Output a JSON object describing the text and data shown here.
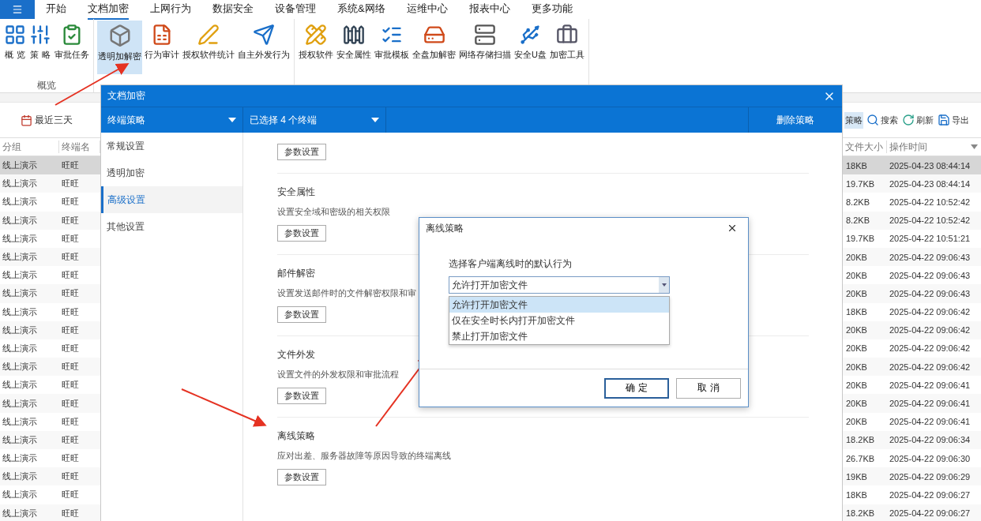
{
  "ribbon": {
    "tabs": [
      {
        "label": "开始",
        "selected": false
      },
      {
        "label": "文档加密",
        "selected": true
      },
      {
        "label": "上网行为",
        "selected": false
      },
      {
        "label": "数据安全",
        "selected": false
      },
      {
        "label": "设备管理",
        "selected": false
      },
      {
        "label": "系统&网络",
        "selected": false
      },
      {
        "label": "运维中心",
        "selected": false
      },
      {
        "label": "报表中心",
        "selected": false
      },
      {
        "label": "更多功能",
        "selected": false
      }
    ],
    "groups": [
      {
        "label": "概览",
        "buttons": [
          {
            "label": "概 览",
            "selected": false
          },
          {
            "label": "策 略",
            "selected": false
          },
          {
            "label": "审批任务",
            "selected": false
          }
        ]
      },
      {
        "buttons": [
          {
            "label": "透明加解密",
            "selected": true
          },
          {
            "label": "行为审计",
            "selected": false
          },
          {
            "label": "授权软件统计",
            "selected": false
          },
          {
            "label": "自主外发行为",
            "selected": false
          }
        ]
      },
      {
        "buttons": [
          {
            "label": "授权软件",
            "selected": false
          },
          {
            "label": "安全属性",
            "selected": false
          },
          {
            "label": "审批模板",
            "selected": false
          },
          {
            "label": "全盘加解密",
            "selected": false
          },
          {
            "label": "网络存储扫描",
            "selected": false
          },
          {
            "label": "安全U盘",
            "selected": false
          },
          {
            "label": "加密工具",
            "selected": false
          }
        ]
      }
    ]
  },
  "toolbar_left": {
    "date_range": "最近三天"
  },
  "toolbar_right": [
    {
      "label": "策略",
      "selected": true
    },
    {
      "label": "搜索",
      "selected": false
    },
    {
      "label": "刷新",
      "selected": false
    },
    {
      "label": "导出",
      "selected": false
    }
  ],
  "table": {
    "columns": [
      "分组",
      "终端名",
      "文件大小",
      "操作时间"
    ],
    "rows": [
      {
        "group": "线上演示",
        "terminal": "旺旺",
        "size": "18KB",
        "time": "2025-04-23 08:44:14",
        "selected": true
      },
      {
        "group": "线上演示",
        "terminal": "旺旺",
        "size": "19.7KB",
        "time": "2025-04-23 08:44:14",
        "selected": false
      },
      {
        "group": "线上演示",
        "terminal": "旺旺",
        "size": "8.2KB",
        "time": "2025-04-22 10:52:42",
        "selected": false
      },
      {
        "group": "线上演示",
        "terminal": "旺旺",
        "size": "8.2KB",
        "time": "2025-04-22 10:52:42",
        "selected": false
      },
      {
        "group": "线上演示",
        "terminal": "旺旺",
        "size": "19.7KB",
        "time": "2025-04-22 10:51:21",
        "selected": false
      },
      {
        "group": "线上演示",
        "terminal": "旺旺",
        "size": "20KB",
        "time": "2025-04-22 09:06:43",
        "selected": false
      },
      {
        "group": "线上演示",
        "terminal": "旺旺",
        "size": "20KB",
        "time": "2025-04-22 09:06:43",
        "selected": false
      },
      {
        "group": "线上演示",
        "terminal": "旺旺",
        "size": "20KB",
        "time": "2025-04-22 09:06:43",
        "selected": false
      },
      {
        "group": "线上演示",
        "terminal": "旺旺",
        "size": "18KB",
        "time": "2025-04-22 09:06:42",
        "selected": false
      },
      {
        "group": "线上演示",
        "terminal": "旺旺",
        "size": "20KB",
        "time": "2025-04-22 09:06:42",
        "selected": false
      },
      {
        "group": "线上演示",
        "terminal": "旺旺",
        "size": "20KB",
        "time": "2025-04-22 09:06:42",
        "selected": false
      },
      {
        "group": "线上演示",
        "terminal": "旺旺",
        "size": "20KB",
        "time": "2025-04-22 09:06:42",
        "selected": false
      },
      {
        "group": "线上演示",
        "terminal": "旺旺",
        "size": "20KB",
        "time": "2025-04-22 09:06:41",
        "selected": false
      },
      {
        "group": "线上演示",
        "terminal": "旺旺",
        "size": "20KB",
        "time": "2025-04-22 09:06:41",
        "selected": false
      },
      {
        "group": "线上演示",
        "terminal": "旺旺",
        "size": "20KB",
        "time": "2025-04-22 09:06:41",
        "selected": false
      },
      {
        "group": "线上演示",
        "terminal": "旺旺",
        "size": "18.2KB",
        "time": "2025-04-22 09:06:34",
        "selected": false
      },
      {
        "group": "线上演示",
        "terminal": "旺旺",
        "size": "26.7KB",
        "time": "2025-04-22 09:06:30",
        "selected": false
      },
      {
        "group": "线上演示",
        "terminal": "旺旺",
        "size": "19KB",
        "time": "2025-04-22 09:06:29",
        "selected": false
      },
      {
        "group": "线上演示",
        "terminal": "旺旺",
        "size": "18KB",
        "time": "2025-04-22 09:06:27",
        "selected": false
      },
      {
        "group": "线上演示",
        "terminal": "旺旺",
        "size": "18.2KB",
        "time": "2025-04-22 09:06:27",
        "selected": false
      }
    ]
  },
  "dialog": {
    "title": "文档加密",
    "policy_select": "终端策略",
    "terminal_select": "已选择 4 个终端",
    "delete_button": "删除策略",
    "nav": [
      {
        "label": "常规设置",
        "selected": false
      },
      {
        "label": "透明加密",
        "selected": false
      },
      {
        "label": "高级设置",
        "selected": true
      },
      {
        "label": "其他设置",
        "selected": false
      }
    ],
    "sections": [
      {
        "button": "参数设置"
      },
      {
        "title": "安全属性",
        "description": "设置安全域和密级的相关权限",
        "button": "参数设置"
      },
      {
        "title": "邮件解密",
        "description": "设置发送邮件时的文件解密权限和审",
        "button": "参数设置"
      },
      {
        "title": "文件外发",
        "description": "设置文件的外发权限和审批流程",
        "button": "参数设置"
      },
      {
        "title": "离线策略",
        "description": "应对出差、服务器故障等原因导致的终端离线",
        "button": "参数设置"
      }
    ]
  },
  "offline_dialog": {
    "title": "离线策略",
    "prompt": "选择客户端离线时的默认行为",
    "select": {
      "value": "允许打开加密文件",
      "expanded": true
    },
    "options": [
      {
        "label": "允许打开加密文件",
        "selected": true
      },
      {
        "label": "仅在安全时长内打开加密文件",
        "selected": false
      },
      {
        "label": "禁止打开加密文件",
        "selected": false
      }
    ],
    "buttons": [
      {
        "label": "确 定",
        "kind": "primary"
      },
      {
        "label": "取 消",
        "kind": "secondary"
      }
    ]
  }
}
